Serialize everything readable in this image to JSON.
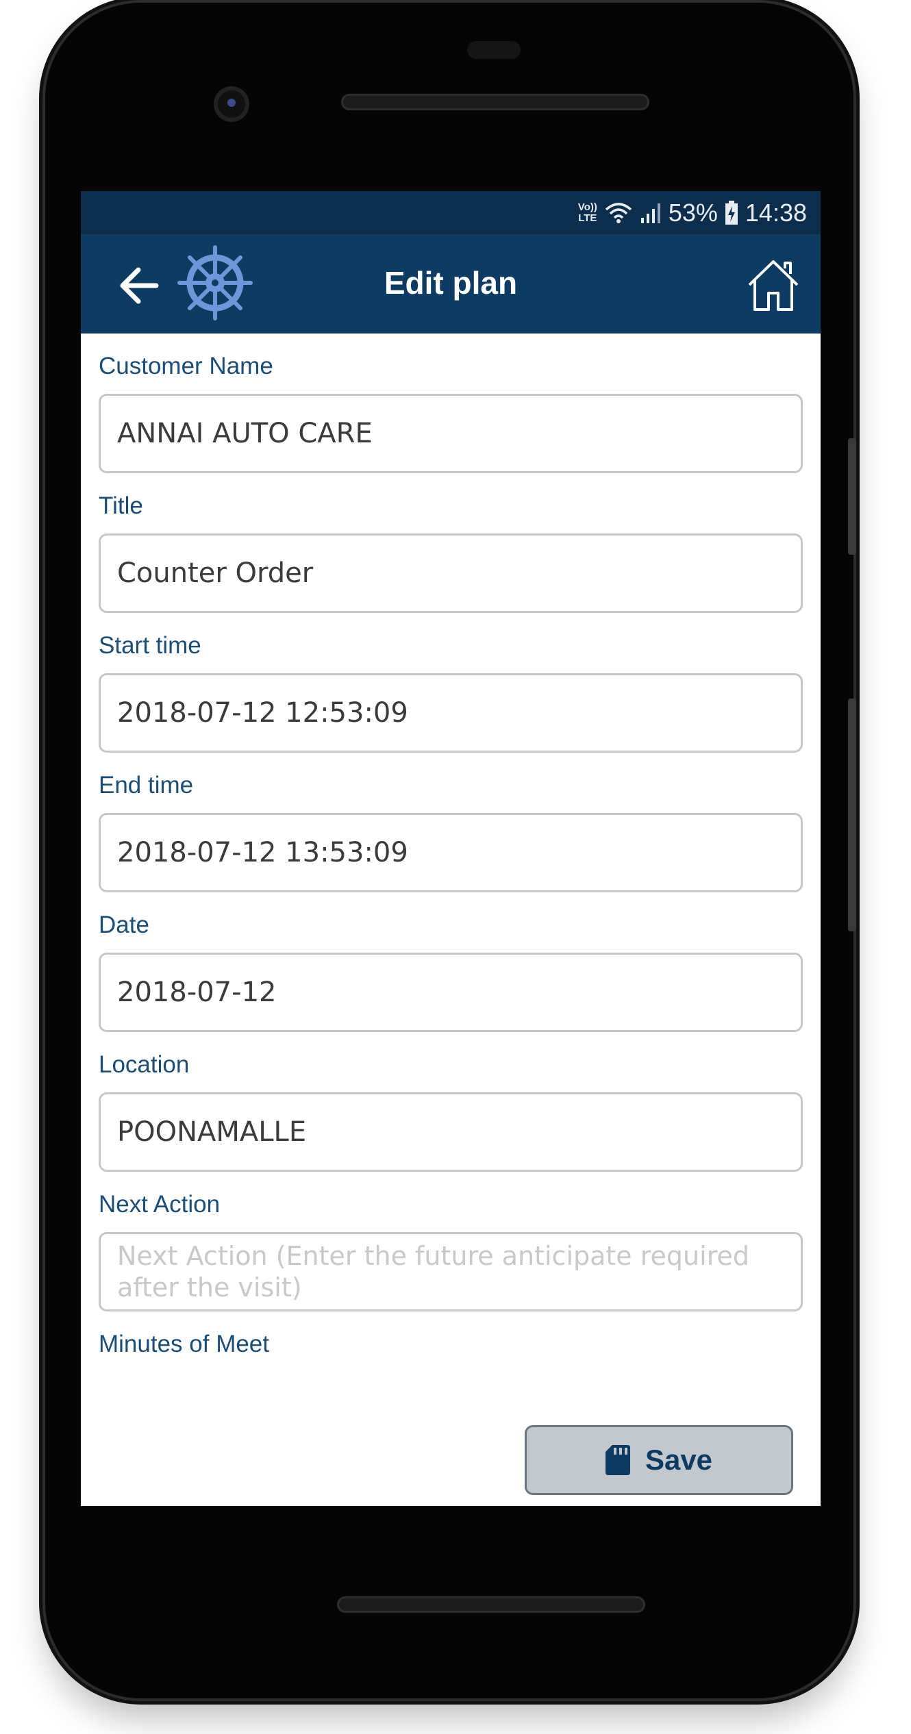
{
  "status_bar": {
    "network_top": "Vo))",
    "network_bottom": "LTE",
    "battery_percent": "53%",
    "time": "14:38"
  },
  "app_bar": {
    "title": "Edit plan",
    "back_icon": "arrow-left-icon",
    "logo_icon": "ship-wheel-icon",
    "home_icon": "home-icon",
    "background_color": "#0e3b61",
    "logo_color": "#6f96d8"
  },
  "form": {
    "fields": [
      {
        "label": "Customer Name",
        "value": "ANNAI AUTO CARE"
      },
      {
        "label": "Title",
        "value": "Counter Order"
      },
      {
        "label": "Start time",
        "value": "2018-07-12 12:53:09"
      },
      {
        "label": "End time",
        "value": "2018-07-12 13:53:09"
      },
      {
        "label": "Date",
        "value": "2018-07-12"
      },
      {
        "label": "Location",
        "value": "POONAMALLE"
      },
      {
        "label": "Next Action",
        "value": "",
        "placeholder": "Next Action (Enter the future anticipate required after the visit)"
      }
    ],
    "minutes_label": "Minutes of Meet"
  },
  "save_button": {
    "label": "Save",
    "icon": "sd-card-icon"
  }
}
